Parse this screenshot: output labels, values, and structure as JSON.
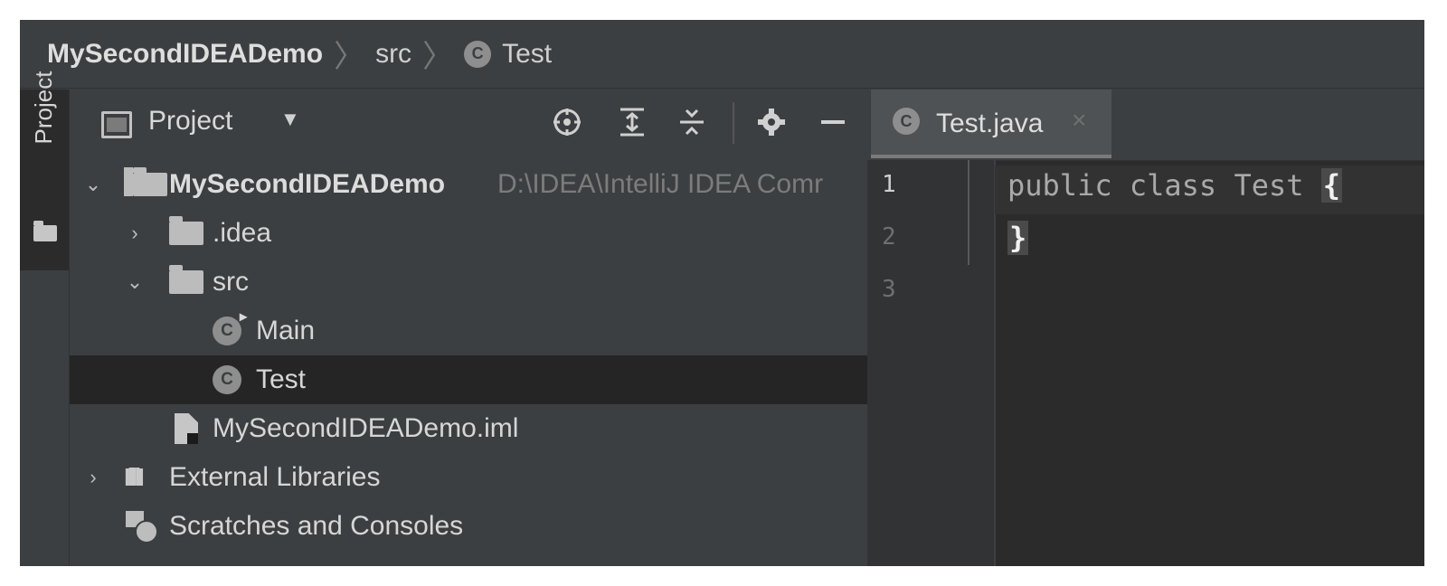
{
  "breadcrumb": {
    "project": "MySecondIDEADemo",
    "folder": "src",
    "class_icon": "C",
    "class": "Test"
  },
  "tool_window_strip": {
    "project_label": "Project"
  },
  "project_panel": {
    "view_label": "Project",
    "header_icons": [
      "locate-icon",
      "expand-all-icon",
      "collapse-all-icon",
      "gear-icon",
      "minimize-icon"
    ],
    "tree": {
      "root_name": "MySecondIDEADemo",
      "root_path": "D:\\IDEA\\IntelliJ IDEA Comr",
      "idea_folder": ".idea",
      "src_folder": "src",
      "main_class_icon": "C",
      "main_class": "Main",
      "test_class_icon": "C",
      "test_class": "Test",
      "iml_file": "MySecondIDEADemo.iml",
      "external_libraries": "External Libraries",
      "scratches": "Scratches and Consoles"
    },
    "selected_item": "Test"
  },
  "editor": {
    "tab_icon": "C",
    "tab_label": "Test.java",
    "tab_close": "×",
    "line_numbers": [
      "1",
      "2",
      "3"
    ],
    "code": {
      "line1": "public class Test ",
      "line1_brace": "{",
      "line2_brace": "}"
    }
  },
  "colors": {
    "background": "#3c3f41",
    "editor_background": "#2b2b2b",
    "selection": "#252525"
  }
}
